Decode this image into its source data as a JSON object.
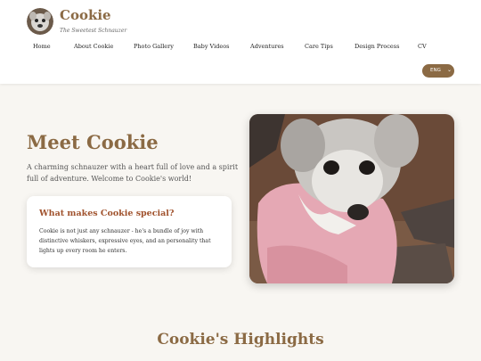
{
  "brand": {
    "name": "Cookie",
    "tagline": "The Sweetest Schnauzer"
  },
  "nav": {
    "items": [
      {
        "label": "Home"
      },
      {
        "label": "About Cookie"
      },
      {
        "label": "Photo Gallery"
      },
      {
        "label": "Baby Videos"
      },
      {
        "label": "Adventures"
      },
      {
        "label": "Care Tips"
      },
      {
        "label": "Design Process"
      },
      {
        "label": "CV"
      }
    ]
  },
  "language": {
    "selected": "ENG"
  },
  "hero": {
    "title": "Meet Cookie",
    "description": "A charming schnauzer with a heart full of love and a spirit full of adventure. Welcome to Cookie's world!",
    "card": {
      "title": "What makes Cookie special?",
      "text": "Cookie is not just any schnauzer - he's a bundle of joy with distinctive whiskers, expressive eyes, and an personality that lights up every room he enters."
    }
  },
  "highlights": {
    "title": "Cookie's Highlights"
  },
  "colors": {
    "accent": "#8b6a44",
    "card_title": "#a0522d",
    "background": "#f8f6f2"
  }
}
